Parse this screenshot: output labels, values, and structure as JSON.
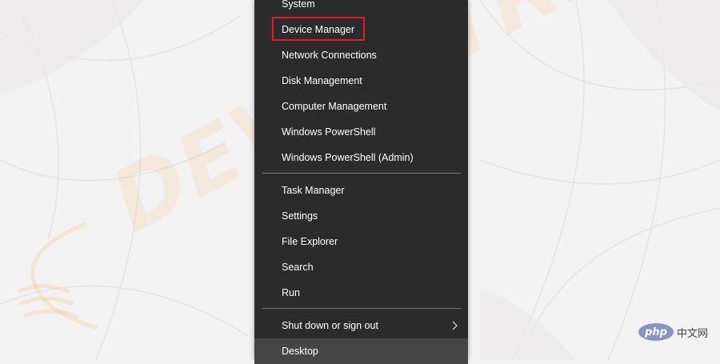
{
  "background": {
    "color": "#f3f2f2",
    "watermark_text": "DEVICETRICKS"
  },
  "menu": {
    "background": "#2b2b2b",
    "items": [
      {
        "label": "System"
      },
      {
        "label": "Device Manager",
        "highlighted": true
      },
      {
        "label": "Network Connections"
      },
      {
        "label": "Disk Management"
      },
      {
        "label": "Computer Management"
      },
      {
        "label": "Windows PowerShell"
      },
      {
        "label": "Windows PowerShell (Admin)"
      },
      {
        "label": "Task Manager"
      },
      {
        "label": "Settings"
      },
      {
        "label": "File Explorer"
      },
      {
        "label": "Search"
      },
      {
        "label": "Run"
      },
      {
        "label": "Shut down or sign out",
        "has_submenu": true
      },
      {
        "label": "Desktop",
        "selected": true
      }
    ],
    "highlight_color": "#e31b23"
  },
  "badge": {
    "logo_text": "php",
    "site_text": "中文网"
  }
}
